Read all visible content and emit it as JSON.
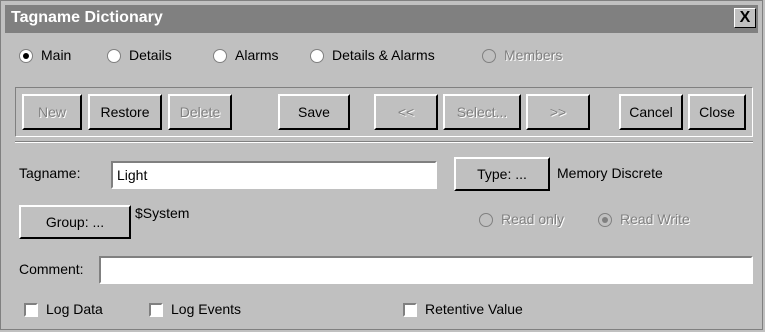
{
  "window": {
    "title": "Tagname Dictionary",
    "close_label": "X"
  },
  "view_tabs": {
    "main": "Main",
    "details": "Details",
    "alarms": "Alarms",
    "details_alarms": "Details & Alarms",
    "members": "Members"
  },
  "toolbar": {
    "new": "New",
    "restore": "Restore",
    "delete": "Delete",
    "save": "Save",
    "prev": "<<",
    "select": "Select...",
    "next": ">>",
    "cancel": "Cancel",
    "close": "Close"
  },
  "form": {
    "tagname_label": "Tagname:",
    "tagname_value": "Light",
    "type_button": "Type: ...",
    "type_value": "Memory Discrete",
    "group_button": "Group: ...",
    "group_value": "$System",
    "read_only": "Read only",
    "read_write": "Read Write",
    "comment_label": "Comment:",
    "comment_value": "",
    "log_data": "Log Data",
    "log_events": "Log Events",
    "retentive_value": "Retentive Value"
  }
}
